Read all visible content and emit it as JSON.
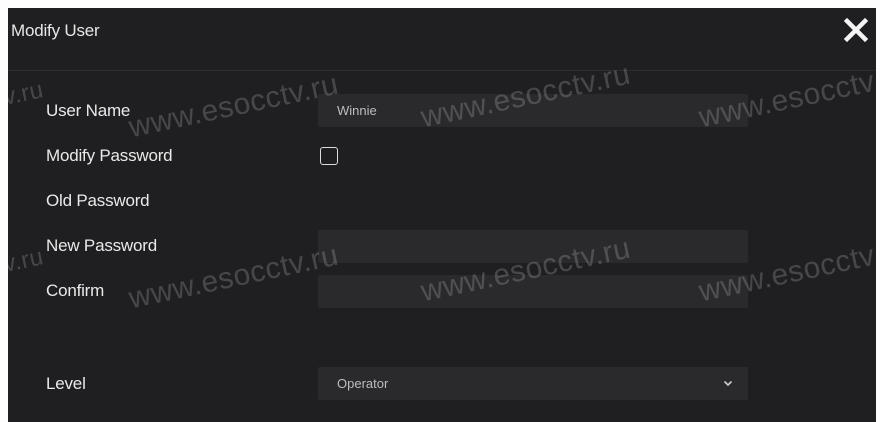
{
  "dialog": {
    "title": "Modify User",
    "close_icon": "close-icon"
  },
  "form": {
    "user_name_label": "User Name",
    "user_name_value": "Winnie",
    "modify_password_label": "Modify Password",
    "modify_password_checked": false,
    "old_password_label": "Old Password",
    "new_password_label": "New Password",
    "new_password_value": "",
    "confirm_label": "Confirm",
    "confirm_value": "",
    "level_label": "Level",
    "level_value": "Operator",
    "level_icon": "chevron-down-icon"
  },
  "watermark": {
    "text": "www.esocctv.ru",
    "fragment": "tv.ru"
  },
  "colors": {
    "dialog_bg": "#1f1f21",
    "field_bg": "#2a2a2d",
    "text": "#e9e9e9"
  }
}
